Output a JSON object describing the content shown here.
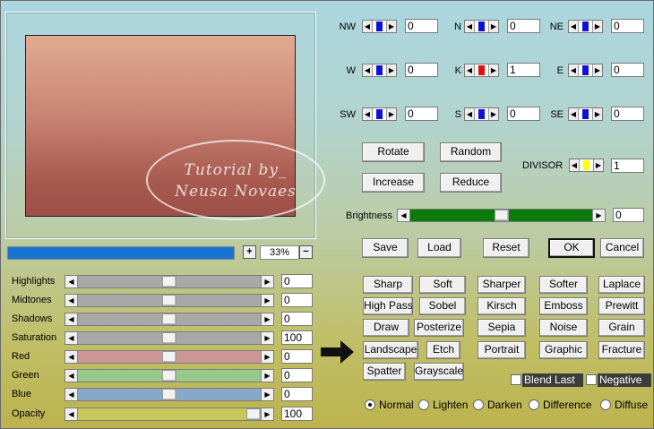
{
  "preview": {
    "watermark_line1": "Tutorial by_",
    "watermark_line2": "Neusa Novaes"
  },
  "zoom": {
    "progress": 1.0,
    "plus": "+",
    "value": "33%",
    "minus": "−"
  },
  "sliders": [
    {
      "label": "Highlights",
      "value": "0",
      "color": "#a8a8a8",
      "position": 0.5
    },
    {
      "label": "Midtones",
      "value": "0",
      "color": "#a8a8a8",
      "position": 0.5
    },
    {
      "label": "Shadows",
      "value": "0",
      "color": "#a8a8a8",
      "position": 0.5
    },
    {
      "label": "Saturation",
      "value": "100",
      "color": "#a8a8a8",
      "position": 0.5
    },
    {
      "label": "Red",
      "value": "0",
      "color": "#cc9696",
      "position": 0.5
    },
    {
      "label": "Green",
      "value": "0",
      "color": "#98c98c",
      "position": 0.5
    },
    {
      "label": "Blue",
      "value": "0",
      "color": "#88a8c8",
      "position": 0.5
    },
    {
      "label": "Opacity",
      "value": "100",
      "color": "#c8c85a",
      "position": 1.0
    }
  ],
  "matrix": [
    {
      "label": "NW",
      "value": "0",
      "indicator": "#1010d8"
    },
    {
      "label": "N",
      "value": "0",
      "indicator": "#1010d8"
    },
    {
      "label": "NE",
      "value": "0",
      "indicator": "#1010d8"
    },
    {
      "label": "W",
      "value": "0",
      "indicator": "#1010d8"
    },
    {
      "label": "K",
      "value": "1",
      "indicator": "#e01010"
    },
    {
      "label": "E",
      "value": "0",
      "indicator": "#1010d8"
    },
    {
      "label": "SW",
      "value": "0",
      "indicator": "#1010d8"
    },
    {
      "label": "S",
      "value": "0",
      "indicator": "#1010d8"
    },
    {
      "label": "SE",
      "value": "0",
      "indicator": "#1010d8"
    }
  ],
  "matrix_buttons": {
    "rotate": "Rotate",
    "random": "Random",
    "increase": "Increase",
    "reduce": "Reduce"
  },
  "divisor": {
    "label": "DIVISOR",
    "value": "1",
    "indicator": "#ffff00"
  },
  "brightness": {
    "label": "Brightness",
    "value": "0",
    "position": 0.5,
    "track_color": "#0a7a0a"
  },
  "actions": {
    "save": "Save",
    "load": "Load",
    "reset": "Reset",
    "ok": "OK",
    "cancel": "Cancel"
  },
  "presets": [
    [
      "Sharp",
      "Soft",
      "Sharper",
      "Softer",
      "Laplace"
    ],
    [
      "High Pass",
      "Sobel",
      "Kirsch",
      "Emboss",
      "Prewitt"
    ],
    [
      "Draw",
      "Posterize",
      "Sepia",
      "Noise",
      "Grain"
    ],
    [
      "Landscape",
      "Etch",
      "Portrait",
      "Graphic",
      "Fracture"
    ],
    [
      "Spatter",
      "Grayscale"
    ]
  ],
  "options": {
    "blend_last": "Blend Last",
    "negative": "Negative"
  },
  "blend_modes": {
    "selected": "Normal",
    "items": [
      "Normal",
      "Lighten",
      "Darken",
      "Difference",
      "Diffuse"
    ]
  },
  "arrow_icon": "arrow-right-icon"
}
